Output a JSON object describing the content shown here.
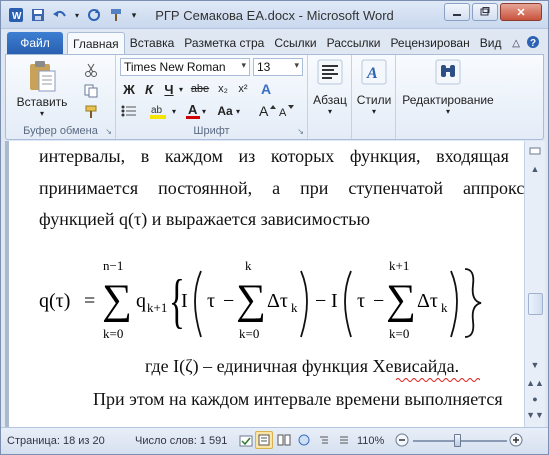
{
  "window": {
    "title": "РГР Семакова ЕА.docx  -  Microsoft Word"
  },
  "ribbon_tabs": {
    "file": "Файл",
    "tabs": [
      "Главная",
      "Вставка",
      "Разметка стра",
      "Ссылки",
      "Рассылки",
      "Рецензирован",
      "Вид"
    ]
  },
  "ribbon": {
    "paste_label": "Вставить",
    "clipboard_group": "Буфер обмена",
    "font_group": "Шрифт",
    "font_name": "Times New Roman",
    "font_size": "13",
    "bold": "Ж",
    "italic": "К",
    "underline": "Ч",
    "strike": "abe",
    "sub": "x₂",
    "sup": "x²",
    "grow": "A",
    "shrink": "A",
    "change_case": "Aa",
    "clear": "A",
    "font_color": "A",
    "paragraph_label": "Абзац",
    "styles_label": "Стили",
    "editing_label": "Редактирование"
  },
  "document": {
    "line1_words": [
      "интервалы,",
      "в",
      "каждом",
      "из",
      "которых",
      "функция,",
      "входящая"
    ],
    "line2_words": [
      "принимается",
      "постоянной,",
      "а",
      "при",
      "ступенчатой",
      "аппрокси"
    ],
    "line3": "функцией  q(τ) и выражается зависимостью",
    "formula": {
      "lhs": "q(τ)",
      "eq": "=",
      "sum_upper": "n−1",
      "sum_lower": "k=0",
      "q_sub": "k+1",
      "inner1_upper": "k",
      "inner1_lower": "k=0",
      "inner2_upper": "k+1",
      "inner2_lower": "k=0",
      "I": "I",
      "tau": "τ",
      "minus": "−",
      "delta_tau": "Δτ",
      "tau_sub": "k"
    },
    "line4": "где I(ζ) – единичная функция Хевисайда.",
    "line5": "При этом на каждом интервале времени выполняется"
  },
  "status": {
    "page": "Страница: 18 из 20",
    "words": "Число слов: 1 591",
    "zoom": "110%"
  },
  "colors": {
    "accent": "#2a5fb0",
    "highlight": "#f5e400",
    "font_color": "#d20000"
  }
}
